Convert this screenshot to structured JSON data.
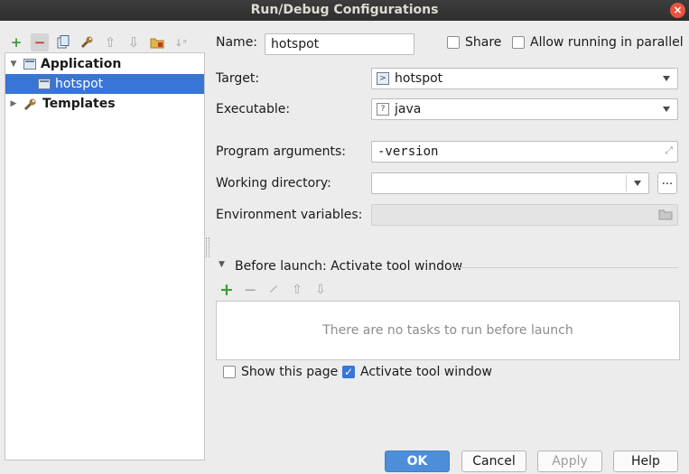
{
  "window": {
    "title": "Run/Debug Configurations",
    "close_glyph": "×"
  },
  "toolbar": {
    "icons": [
      "add-icon",
      "remove-icon",
      "copy-icon",
      "wrench-icon",
      "move-up-icon",
      "move-down-icon",
      "folder-icon",
      "sort-icon"
    ],
    "glyphs": {
      "add": "+",
      "remove": "−",
      "up": "⇧",
      "down": "⇩",
      "sort": "↓ᵃ"
    }
  },
  "tree": {
    "groups": [
      {
        "label": "Application",
        "expanded": true,
        "children": [
          {
            "label": "hotspot",
            "selected": true
          }
        ]
      },
      {
        "label": "Templates",
        "expanded": false
      }
    ]
  },
  "form": {
    "name_label": "Name:",
    "name_value": "hotspot",
    "share_label": "Share",
    "share_checked": false,
    "parallel_label": "Allow running in parallel",
    "parallel_checked": false,
    "target_label": "Target:",
    "target_value": "hotspot",
    "executable_label": "Executable:",
    "executable_value": "java",
    "program_args_label": "Program arguments:",
    "program_args_value": "-version",
    "workdir_label": "Working directory:",
    "workdir_value": "",
    "workdir_browse": "...",
    "envvars_label": "Environment variables:",
    "envvars_value": ""
  },
  "before_launch": {
    "title": "Before launch: Activate tool window",
    "empty_text": "There are no tasks to run before launch",
    "show_page_label": "Show this page",
    "show_page_checked": false,
    "activate_label": "Activate tool window",
    "activate_checked": true
  },
  "buttons": {
    "ok": "OK",
    "cancel": "Cancel",
    "apply": "Apply",
    "help": "Help"
  },
  "colors": {
    "selection": "#3875d6",
    "primary_button": "#4d8ed9",
    "titlebar": "#353535",
    "close": "#e9543f"
  }
}
